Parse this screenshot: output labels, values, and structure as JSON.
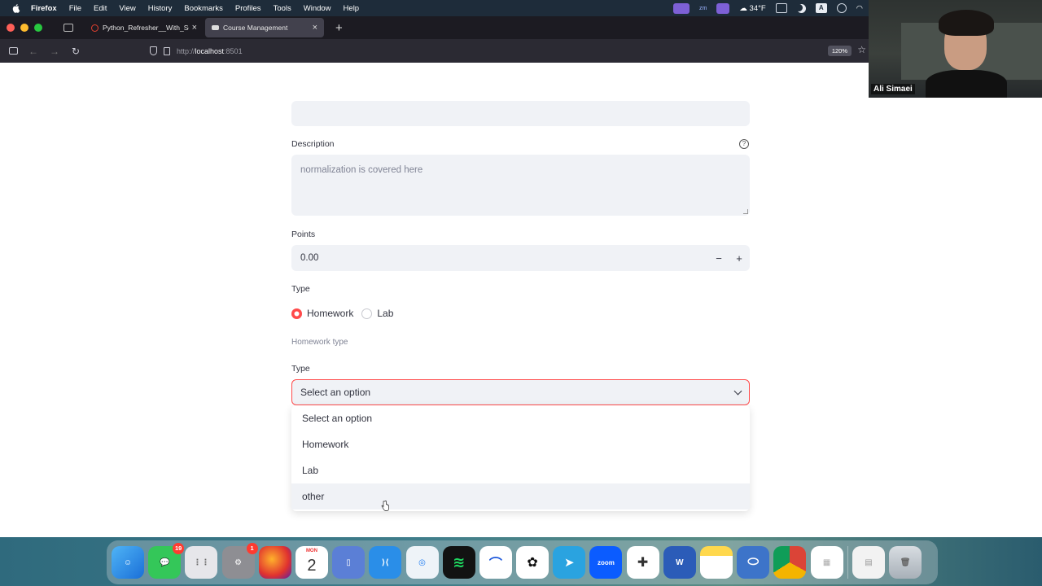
{
  "menubar": {
    "app": "Firefox",
    "items": [
      "File",
      "Edit",
      "View",
      "History",
      "Bookmarks",
      "Profiles",
      "Tools",
      "Window",
      "Help"
    ],
    "weather": "34°F"
  },
  "tabs": [
    {
      "label": "Python_Refresher__With_Soluti",
      "active": false
    },
    {
      "label": "Course Management",
      "active": true
    }
  ],
  "urlbar": {
    "prefix": "http://",
    "host": "localhost",
    "port": ":8501",
    "zoom": "120%"
  },
  "form": {
    "description_label": "Description",
    "description_value": "normalization is covered here",
    "points_label": "Points",
    "points_value": "0.00",
    "minus": "−",
    "plus": "+",
    "type_label": "Type",
    "radio_homework": "Homework",
    "radio_lab": "Lab",
    "homework_type_caption": "Homework type",
    "select_label": "Type",
    "select_value": "Select an option",
    "options": [
      "Select an option",
      "Homework",
      "Lab",
      "other"
    ]
  },
  "webcam": {
    "name": "Ali Simaei"
  },
  "dock": {
    "messages_badge": "19",
    "settings_badge": "1",
    "calendar_month": "MON",
    "calendar_day": "2",
    "zoom_label": "zoom"
  },
  "colors": {
    "accent": "#ff4b4b",
    "input_bg": "#f0f2f6",
    "text": "#31333f"
  }
}
